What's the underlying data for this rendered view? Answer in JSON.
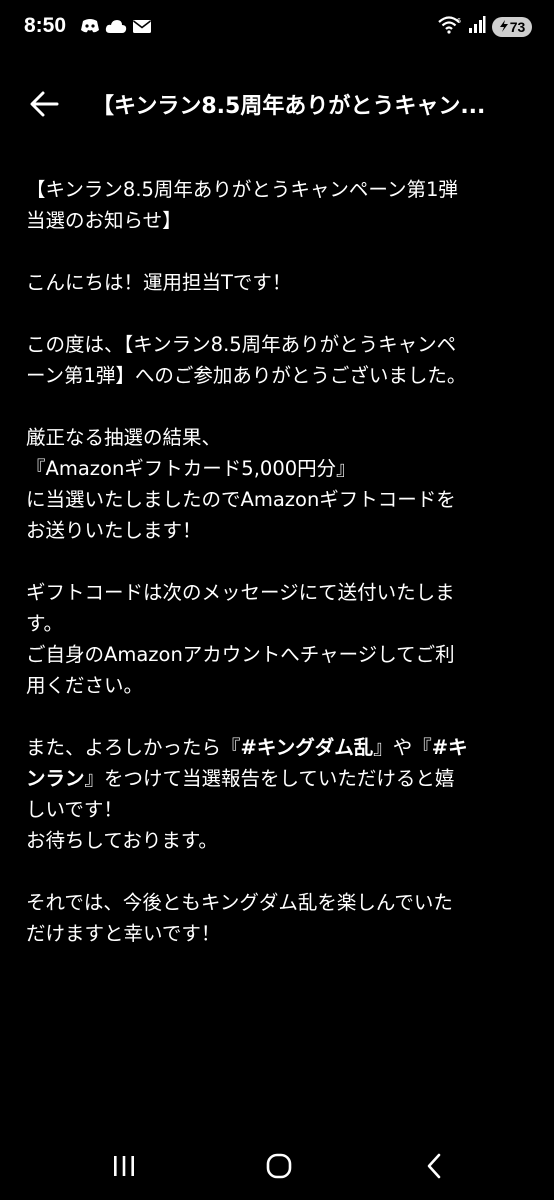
{
  "status_bar": {
    "time": "8:50",
    "battery": "73",
    "notification_icons": [
      "discord-icon",
      "cloud-icon",
      "mail-icon"
    ],
    "system_icons": [
      "wifi-icon",
      "signal-icon"
    ]
  },
  "header": {
    "title": "【キンラン8.5周年ありがとうキャン..."
  },
  "message": {
    "p1": [
      "【キンラン8.5周年ありがとうキャンペーン第1弾",
      "当選のお知らせ】"
    ],
    "p2": [
      "こんにちは！運用担当Tです！"
    ],
    "p3": [
      "この度は、【キンラン8.5周年ありがとうキャンペ",
      "ーン第1弾】へのご参加ありがとうございました。"
    ],
    "p4": [
      "厳正なる抽選の結果、",
      "『Amazonギフトカード5,000円分』",
      "に当選いたしましたのでAmazonギフトコードを",
      "お送りいたします！"
    ],
    "p5": [
      "ギフトコードは次のメッセージにて送付いたしま",
      "す。",
      "ご自身のAmazonアカウントへチャージしてご利",
      "用ください。"
    ],
    "p6": {
      "l1_a": "また、よろしかったら『",
      "l1_b": "#キングダム乱",
      "l1_c": "』や『",
      "l1_d": "#キ",
      "l2_a": "ンラン",
      "l2_b": "』をつけて当選報告をしていただけると嬉",
      "l3": "しいです！",
      "l4": "お待ちしております。"
    },
    "p7": [
      "それでは、今後ともキングダム乱を楽しんでいた",
      "だけますと幸いです！"
    ]
  },
  "nav": {
    "icons": [
      "recent-apps-icon",
      "home-icon",
      "back-icon"
    ]
  }
}
